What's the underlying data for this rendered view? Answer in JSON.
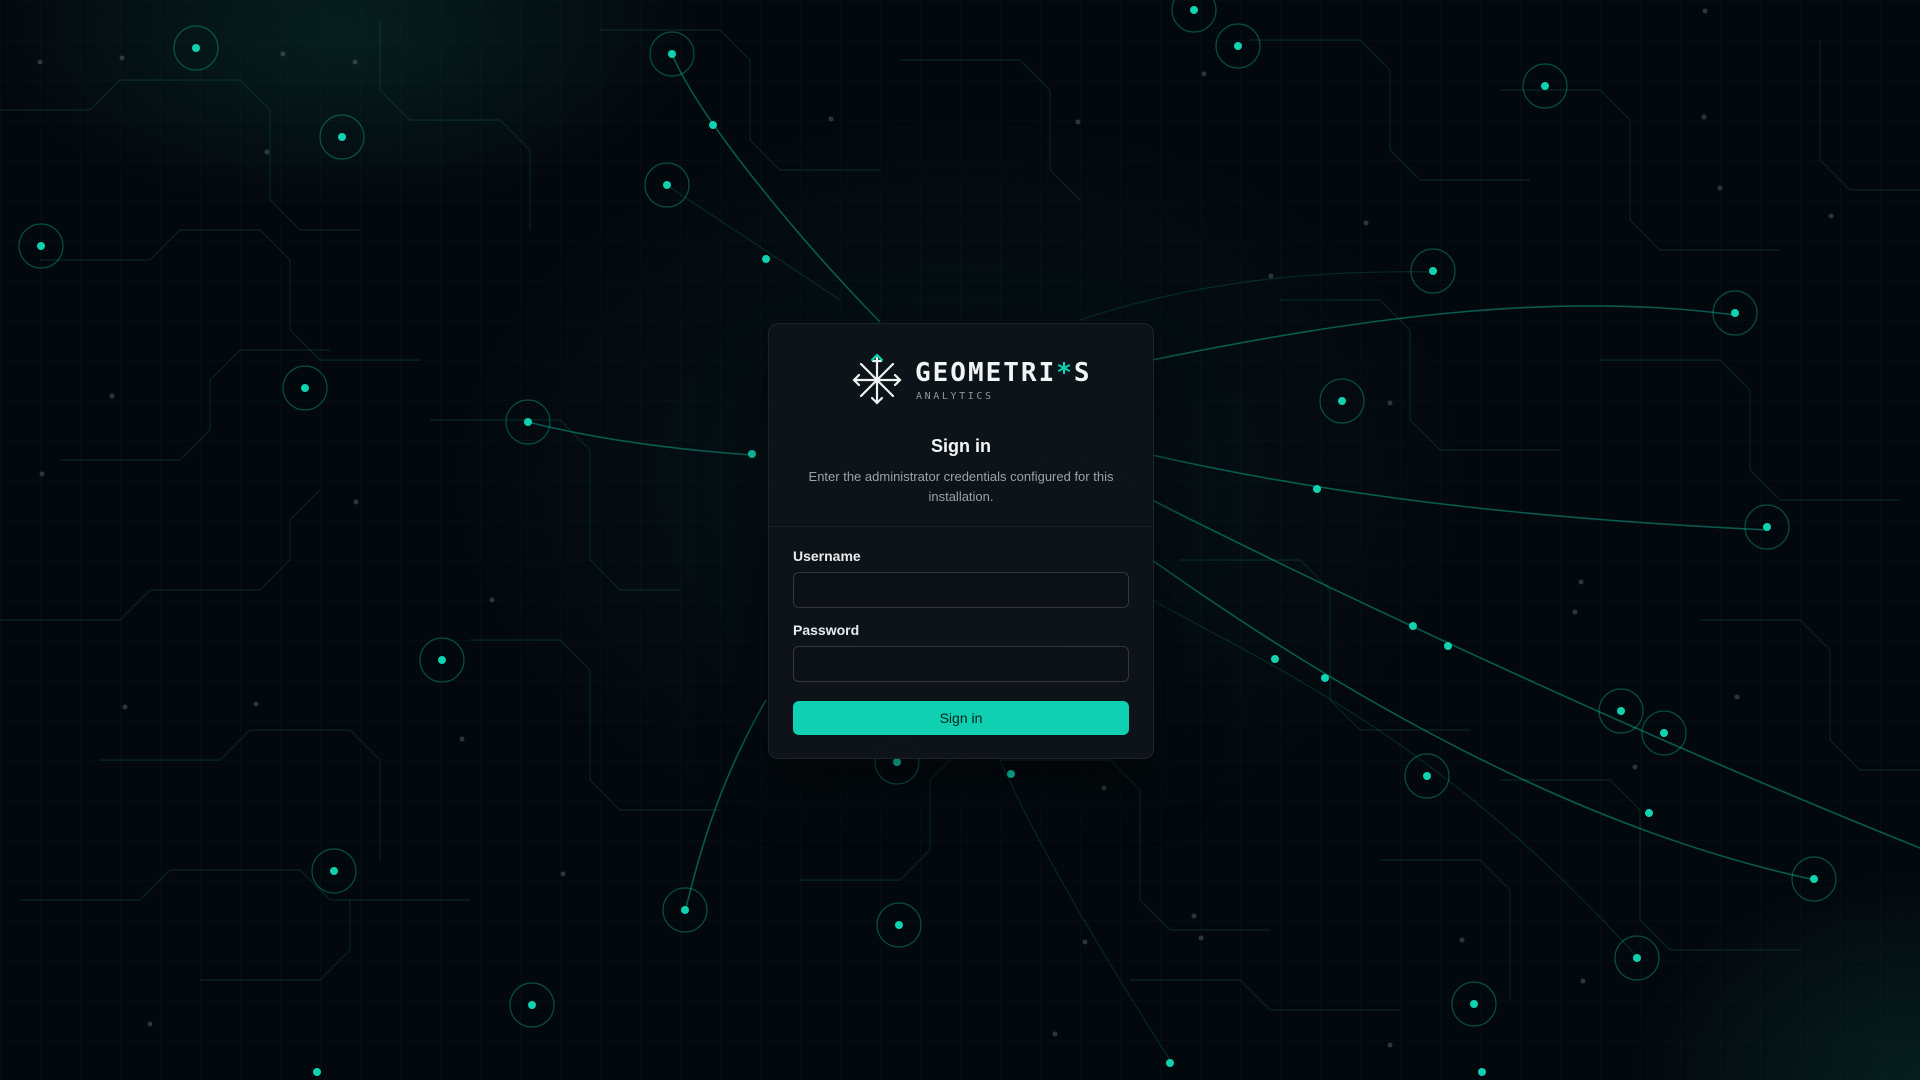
{
  "brand": {
    "name_prefix": "GEOMETRI",
    "name_accent": "*",
    "name_suffix": "S",
    "tagline": "ANALYTICS",
    "icon": "snowflake-star-icon",
    "accent_color": "#0fd1b1"
  },
  "login": {
    "title": "Sign in",
    "subtitle": "Enter the administrator credentials configured for this installation.",
    "username_label": "Username",
    "username_value": "",
    "password_label": "Password",
    "password_value": "",
    "submit_label": "Sign in"
  }
}
